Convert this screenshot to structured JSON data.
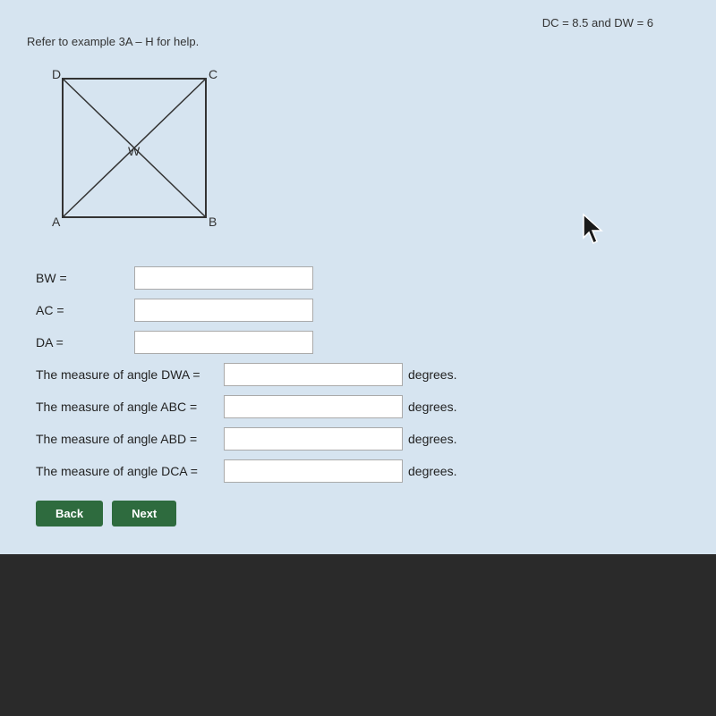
{
  "header": {
    "info_text": "DC = 8.5  and  DW = 6"
  },
  "refer_text": "Refer to example 3A – H for help.",
  "diagram": {
    "labels": {
      "D": "D",
      "C": "C",
      "A": "A",
      "B": "B",
      "W": "W"
    }
  },
  "fields": {
    "bw_label": "BW =",
    "ac_label": "AC =",
    "da_label": "DA =",
    "angle_dwa_label": "The measure of angle DWA =",
    "angle_abc_label": "The measure of angle ABC =",
    "angle_abd_label": "The measure of angle ABD =",
    "angle_dca_label": "The measure of angle DCA =",
    "degrees": "degrees."
  },
  "buttons": {
    "back_label": "Back",
    "next_label": "Next"
  }
}
